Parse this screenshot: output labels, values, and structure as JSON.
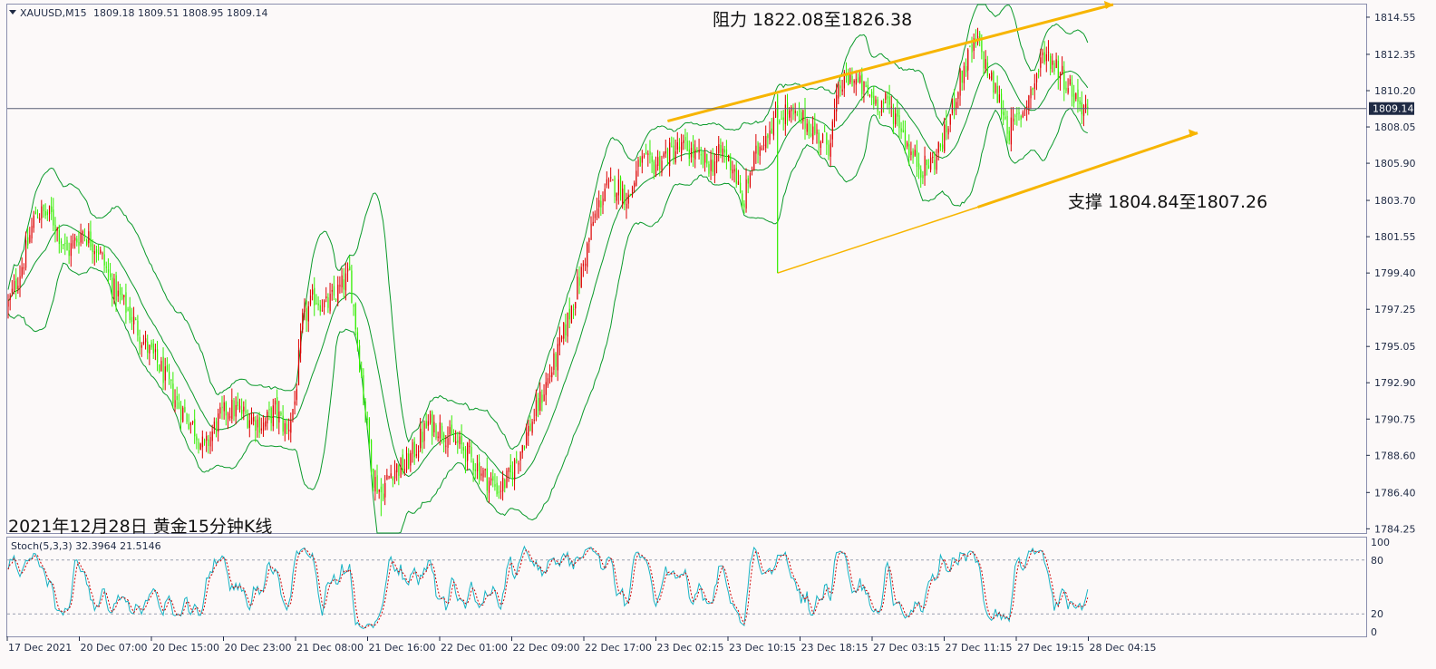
{
  "header": {
    "symbol": "XAUUSD,M15",
    "ohlc": "1809.18 1809.51 1808.95 1809.14"
  },
  "annotations": {
    "resistance": "阻力 1822.08至1826.38",
    "support": "支撑 1804.84至1807.26",
    "caption": "2021年12月28日 黄金15分钟K线"
  },
  "colors": {
    "background": "#fcf9f9",
    "bull": "#dd0000",
    "bear": "#33ee00",
    "bands": "#0a9a2a",
    "channel": "#f7b500",
    "stoch_main": "#17b3c4",
    "stoch_signal": "#cc0000",
    "frame": "#8b8fae",
    "price_line": "#5a6075",
    "price_box": "#1f2a44"
  },
  "chart_data": [
    {
      "type": "candlestick",
      "title": "XAUUSD,M15",
      "last_price": "1809.14",
      "price_axis": [
        "1814.55",
        "1812.35",
        "1810.20",
        "1808.05",
        "1805.90",
        "1803.70",
        "1801.55",
        "1799.40",
        "1797.25",
        "1795.05",
        "1792.90",
        "1790.75",
        "1788.60",
        "1786.40",
        "1784.25"
      ],
      "time_axis": [
        "17 Dec 2021",
        "20 Dec 07:00",
        "20 Dec 15:00",
        "20 Dec 23:00",
        "21 Dec 08:00",
        "21 Dec 16:00",
        "22 Dec 01:00",
        "22 Dec 09:00",
        "22 Dec 17:00",
        "23 Dec 02:15",
        "23 Dec 10:15",
        "23 Dec 18:15",
        "27 Dec 03:15",
        "27 Dec 11:15",
        "27 Dec 19:15",
        "28 Dec 04:15"
      ],
      "ylim": [
        1784.0,
        1815.3
      ],
      "close_path": [
        [
          0,
          1797.5
        ],
        [
          8,
          1800.2
        ],
        [
          14,
          1803.0
        ],
        [
          22,
          1802.8
        ],
        [
          30,
          1800.6
        ],
        [
          38,
          1801.9
        ],
        [
          46,
          1800.8
        ],
        [
          54,
          1798.4
        ],
        [
          62,
          1797.0
        ],
        [
          70,
          1795.1
        ],
        [
          78,
          1793.7
        ],
        [
          86,
          1791.7
        ],
        [
          94,
          1790.4
        ],
        [
          100,
          1788.9
        ],
        [
          106,
          1790.5
        ],
        [
          112,
          1791.4
        ],
        [
          118,
          1791.2
        ],
        [
          124,
          1790.8
        ],
        [
          130,
          1790.4
        ],
        [
          136,
          1791.3
        ],
        [
          142,
          1790.0
        ],
        [
          146,
          1791.8
        ],
        [
          150,
          1796.5
        ],
        [
          156,
          1798.0
        ],
        [
          162,
          1797.4
        ],
        [
          168,
          1798.3
        ],
        [
          174,
          1799.3
        ],
        [
          178,
          1795.4
        ],
        [
          182,
          1791.2
        ],
        [
          186,
          1787.3
        ],
        [
          190,
          1786.4
        ],
        [
          196,
          1787.8
        ],
        [
          202,
          1787.9
        ],
        [
          208,
          1789.1
        ],
        [
          214,
          1790.5
        ],
        [
          220,
          1790.2
        ],
        [
          226,
          1789.5
        ],
        [
          232,
          1789.0
        ],
        [
          238,
          1788.1
        ],
        [
          244,
          1787.2
        ],
        [
          250,
          1786.6
        ],
        [
          256,
          1787.4
        ],
        [
          262,
          1789.3
        ],
        [
          268,
          1790.9
        ],
        [
          274,
          1792.8
        ],
        [
          280,
          1794.6
        ],
        [
          286,
          1797.0
        ],
        [
          292,
          1799.4
        ],
        [
          298,
          1802.4
        ],
        [
          304,
          1804.4
        ],
        [
          310,
          1804.6
        ],
        [
          316,
          1803.8
        ],
        [
          322,
          1806.0
        ],
        [
          328,
          1805.7
        ],
        [
          334,
          1806.3
        ],
        [
          340,
          1806.7
        ],
        [
          346,
          1806.8
        ],
        [
          352,
          1806.1
        ],
        [
          358,
          1805.8
        ],
        [
          364,
          1806.6
        ],
        [
          370,
          1805.6
        ],
        [
          374,
          1803.2
        ],
        [
          378,
          1805.4
        ],
        [
          384,
          1807.3
        ],
        [
          390,
          1808.5
        ],
        [
          396,
          1809.0
        ],
        [
          400,
          1808.6
        ],
        [
          406,
          1808.4
        ],
        [
          412,
          1807.6
        ],
        [
          418,
          1807.0
        ],
        [
          424,
          1810.5
        ],
        [
          430,
          1811.0
        ],
        [
          436,
          1810.2
        ],
        [
          442,
          1809.6
        ],
        [
          448,
          1809.4
        ],
        [
          454,
          1808.4
        ],
        [
          460,
          1806.4
        ],
        [
          466,
          1805.6
        ],
        [
          472,
          1806.1
        ],
        [
          478,
          1807.8
        ],
        [
          484,
          1810.5
        ],
        [
          490,
          1812.4
        ],
        [
          494,
          1813.1
        ],
        [
          500,
          1811.0
        ],
        [
          506,
          1809.3
        ],
        [
          510,
          1807.8
        ],
        [
          516,
          1808.8
        ],
        [
          522,
          1810.4
        ],
        [
          528,
          1812.5
        ],
        [
          534,
          1811.7
        ],
        [
          540,
          1810.6
        ],
        [
          546,
          1809.4
        ],
        [
          550,
          1809.14
        ]
      ]
    },
    {
      "type": "line",
      "title": "Stoch(5,3,3) 32.3964 21.5146",
      "y_axis": [
        "100",
        "80",
        "20",
        "0"
      ],
      "ylim": [
        -5,
        105
      ],
      "levels": [
        80,
        20
      ]
    }
  ]
}
